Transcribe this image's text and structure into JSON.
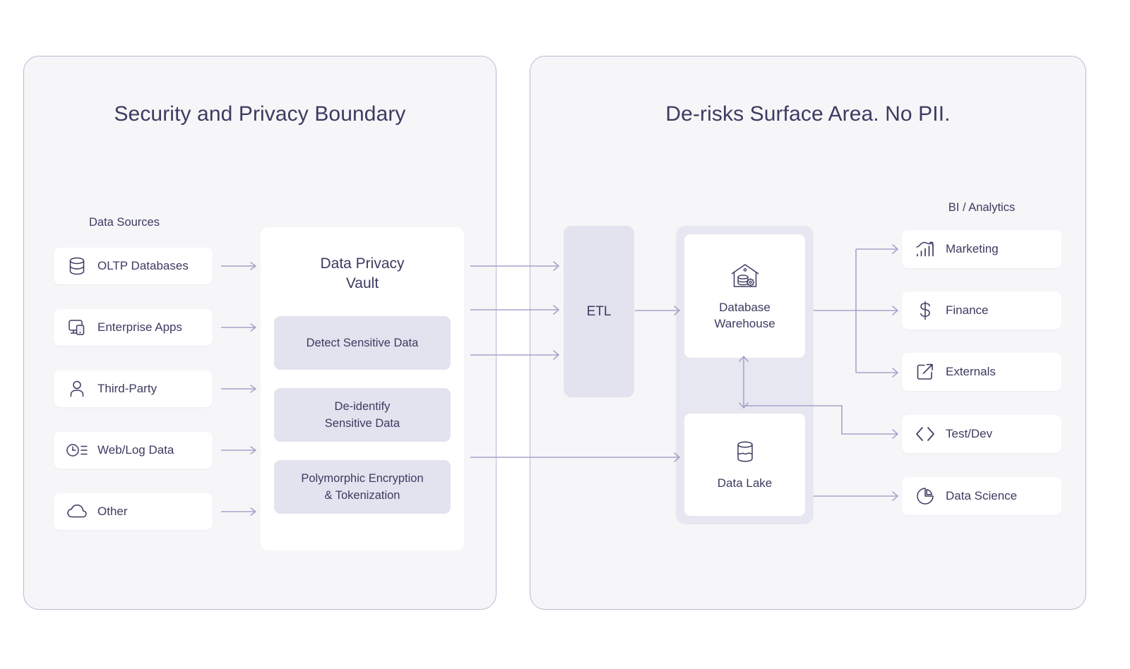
{
  "panels": {
    "left": {
      "title": "Security and Privacy Boundary"
    },
    "right": {
      "title": "De-risks Surface Area. No PII."
    }
  },
  "sources": {
    "caption": "Data Sources",
    "items": [
      {
        "label": "OLTP Databases",
        "icon": "database-icon"
      },
      {
        "label": "Enterprise Apps",
        "icon": "monitor-icon"
      },
      {
        "label": "Third-Party",
        "icon": "user-icon"
      },
      {
        "label": "Web/Log Data",
        "icon": "clock-list-icon"
      },
      {
        "label": "Other",
        "icon": "cloud-icon"
      }
    ]
  },
  "vault": {
    "title": "Data Privacy Vault",
    "title_line1": "Data Privacy",
    "title_line2": "Vault",
    "boxes": [
      {
        "label": "Detect Sensitive Data",
        "line1": "Detect Sensitive Data",
        "line2": ""
      },
      {
        "label": "De-identify Sensitive Data",
        "line1": "De-identify",
        "line2": "Sensitive Data"
      },
      {
        "label": "Polymorphic Encryption & Tokenization",
        "line1": "Polymorphic Encryption",
        "line2": "& Tokenization"
      }
    ]
  },
  "etl": {
    "label": "ETL"
  },
  "stores": [
    {
      "label": "Database Warehouse",
      "line1": "Database",
      "line2": "Warehouse",
      "icon": "warehouse-database-icon"
    },
    {
      "label": "Data Lake",
      "line1": "Data Lake",
      "line2": "",
      "icon": "data-lake-icon"
    }
  ],
  "bi": {
    "caption": "BI / Analytics",
    "items": [
      {
        "label": "Marketing",
        "icon": "chart-trend-icon"
      },
      {
        "label": "Finance",
        "icon": "dollar-icon"
      },
      {
        "label": "Externals",
        "icon": "external-link-icon"
      },
      {
        "label": "Test/Dev",
        "icon": "code-brackets-icon"
      },
      {
        "label": "Data Science",
        "icon": "pie-chart-icon"
      }
    ]
  },
  "colors": {
    "text": "#3c3b61",
    "panel_bg": "#f6f6f8",
    "panel_border": "#b9b9d4",
    "accent_fill": "#e3e3ef",
    "wire": "#a6a4cb",
    "card_bg": "#ffffff"
  }
}
